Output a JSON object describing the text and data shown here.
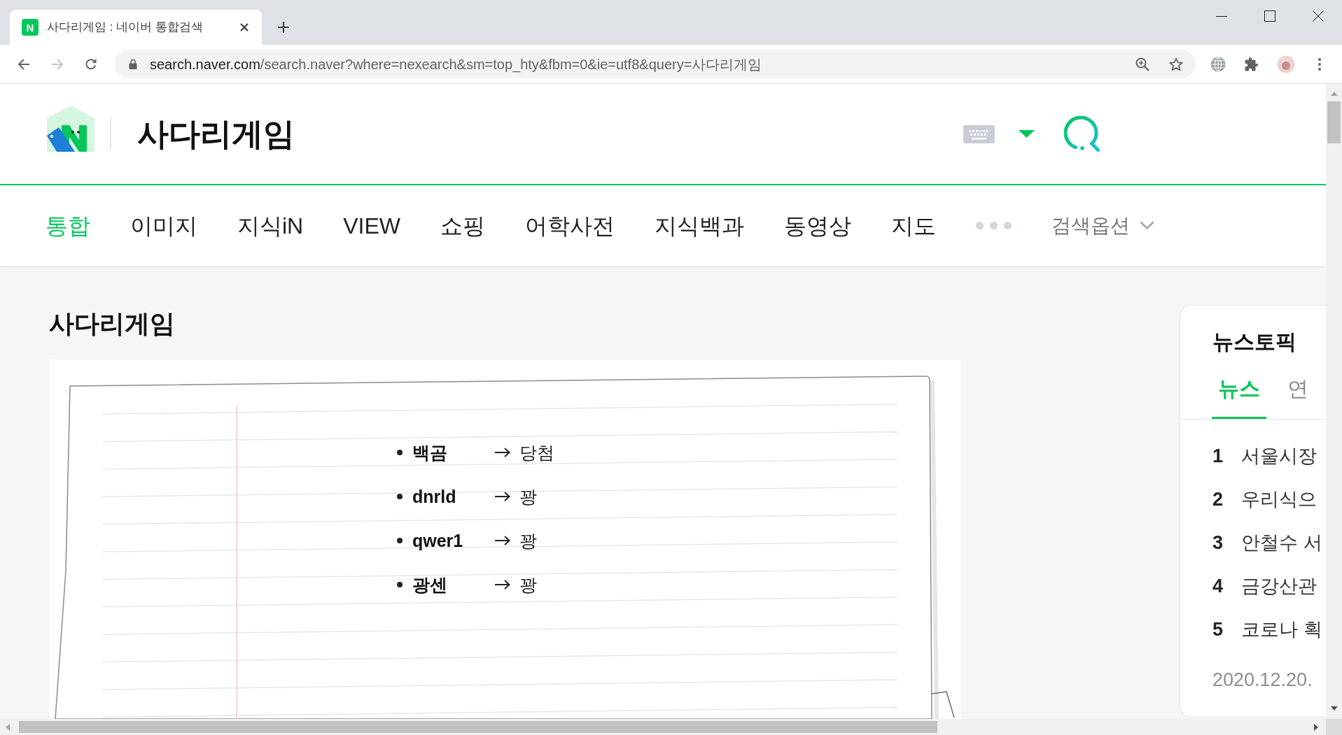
{
  "browser": {
    "tab": {
      "favicon": "N",
      "title": "사다리게임 : 네이버 통합검색"
    },
    "toolbar": {
      "buttons": [
        {
          "kind": "back",
          "disabled": false
        },
        {
          "kind": "forward",
          "disabled": true
        },
        {
          "kind": "reload",
          "disabled": false
        }
      ]
    },
    "address": {
      "domain": "search.naver.com",
      "path": "/search.naver?where=nexearch&sm=top_hty&fbm=0&ie=utf8&query=사다리게임"
    }
  },
  "search": {
    "value": "사다리게임"
  },
  "nav_tabs": [
    {
      "label": "통합",
      "selected": true
    },
    {
      "label": "이미지",
      "selected": false
    },
    {
      "label": "지식iN",
      "selected": false
    },
    {
      "label": "VIEW",
      "selected": false
    },
    {
      "label": "쇼핑",
      "selected": false
    },
    {
      "label": "어학사전",
      "selected": false
    },
    {
      "label": "지식백과",
      "selected": false
    },
    {
      "label": "동영상",
      "selected": false
    },
    {
      "label": "지도",
      "selected": false
    }
  ],
  "search_options": {
    "label": "검색옵션"
  },
  "section": {
    "title": "사다리게임",
    "entries": [
      {
        "name": "백곰",
        "outcome": "당첨"
      },
      {
        "name": "dnrld",
        "outcome": "꽝"
      },
      {
        "name": "qwer1",
        "outcome": "꽝"
      },
      {
        "name": "광센",
        "outcome": "꽝"
      }
    ]
  },
  "news_topic": {
    "title": "뉴스토픽",
    "tabs": [
      {
        "label": "뉴스",
        "selected": true
      },
      {
        "label": "연",
        "selected": false
      }
    ],
    "items": [
      {
        "rank": "1",
        "headline": "서울시장"
      },
      {
        "rank": "2",
        "headline": "우리식으"
      },
      {
        "rank": "3",
        "headline": "안철수 서"
      },
      {
        "rank": "4",
        "headline": "금강산관"
      },
      {
        "rank": "5",
        "headline": "코로나 획"
      }
    ],
    "date": "2020.12.20."
  }
}
